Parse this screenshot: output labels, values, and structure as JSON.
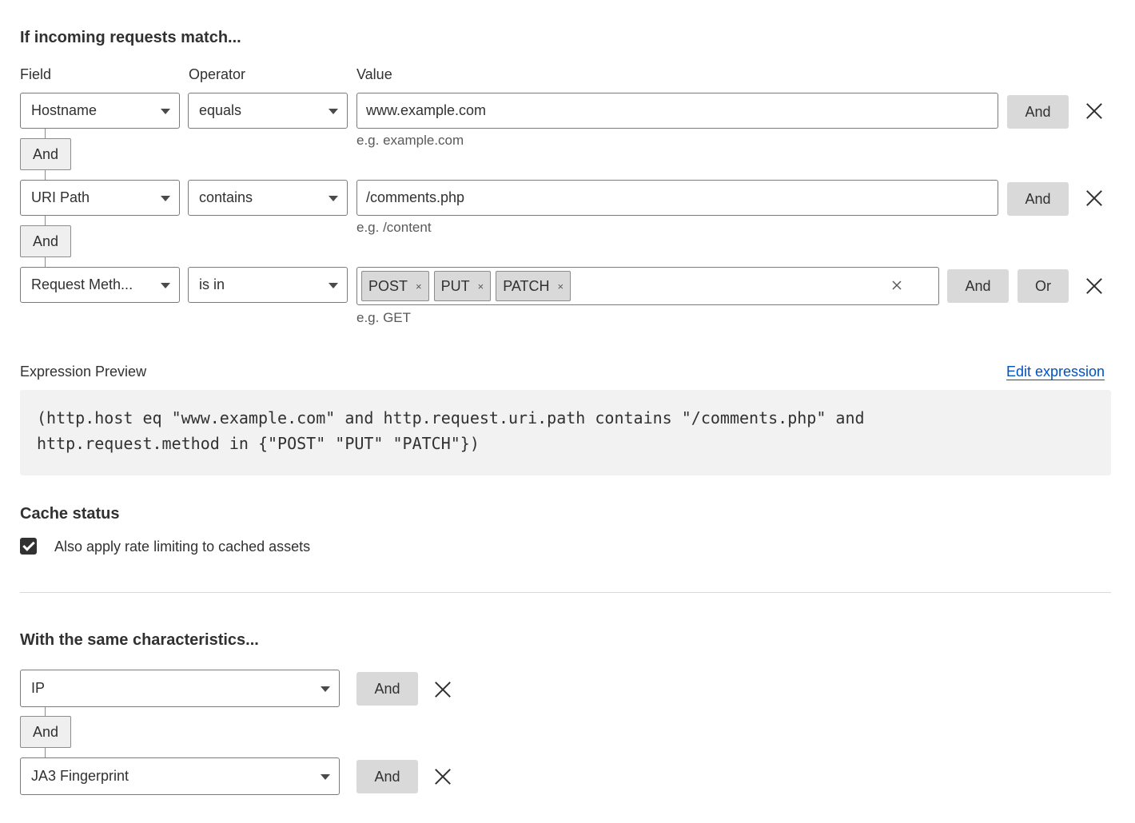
{
  "match": {
    "title": "If incoming requests match...",
    "headers": {
      "field": "Field",
      "operator": "Operator",
      "value": "Value"
    },
    "rows": [
      {
        "field": "Hostname",
        "operator": "equals",
        "value": "www.example.com",
        "hint": "e.g. example.com",
        "and": "And"
      },
      {
        "field": "URI Path",
        "operator": "contains",
        "value": "/comments.php",
        "hint": "e.g. /content",
        "and": "And"
      },
      {
        "field": "Request Meth...",
        "operator": "is in",
        "tags": [
          "POST",
          "PUT",
          "PATCH"
        ],
        "hint": "e.g. GET",
        "and": "And",
        "or": "Or"
      }
    ],
    "connector": "And",
    "tag_remove": "×"
  },
  "expression": {
    "label": "Expression Preview",
    "edit_link": "Edit expression",
    "text": "(http.host eq \"www.example.com\" and http.request.uri.path contains \"/comments.php\" and\nhttp.request.method in {\"POST\" \"PUT\" \"PATCH\"})"
  },
  "cache": {
    "title": "Cache status",
    "checkbox_label": "Also apply rate limiting to cached assets",
    "checked": true
  },
  "characteristics": {
    "title": "With the same characteristics...",
    "rows": [
      {
        "field": "IP",
        "and": "And"
      },
      {
        "field": "JA3 Fingerprint",
        "and": "And"
      }
    ],
    "connector": "And"
  }
}
